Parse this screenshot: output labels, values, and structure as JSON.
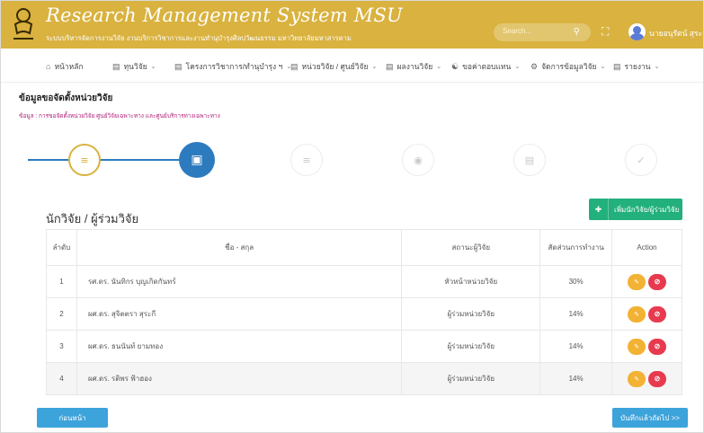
{
  "header": {
    "title": "Research Management System MSU",
    "subtitle": "ระบบบริหารจัดการงานวิจัย งานบริการวิชาการและงานทำนุบำรุงศิลปวัฒนธรรม มหาวิทยาลัยมหาสารคาม",
    "search_placeholder": "Search...",
    "user_name": "นายอนุรัตน์ สุระจันทร์"
  },
  "nav": {
    "items": [
      {
        "label": "หน้าหลัก",
        "icon": "home-icon"
      },
      {
        "label": "ทุนวิจัย",
        "icon": "grant-icon"
      },
      {
        "label": "โครงการวิชาการ/ทำนุบำรุง ฯ",
        "icon": "project-icon"
      },
      {
        "label": "หน่วยวิจัย / ศูนย์วิจัย",
        "icon": "unit-icon"
      },
      {
        "label": "ผลงานวิจัย",
        "icon": "output-icon"
      },
      {
        "label": "ขอค่าตอบแทน",
        "icon": "reward-icon"
      },
      {
        "label": "จัดการข้อมูลวิจัย",
        "icon": "settings-icon"
      },
      {
        "label": "รายงาน",
        "icon": "report-icon"
      }
    ]
  },
  "page": {
    "title": "ข้อมูลขอจัดตั้งหน่วยวิจัย",
    "subtitle": "ข้อมูล : การขอจัดตั้งหน่วยวิจัย ศูนย์วิจัยเฉพาะทาง และศูนย์บริการทางเฉพาะทาง"
  },
  "stepper": {
    "steps": [
      {
        "state": "done",
        "icon": "list-icon"
      },
      {
        "state": "active",
        "icon": "document-icon"
      },
      {
        "state": "todo",
        "icon": "list-icon"
      },
      {
        "state": "todo",
        "icon": "coin-icon"
      },
      {
        "state": "todo",
        "icon": "file-icon"
      },
      {
        "state": "todo",
        "icon": "check-circle-icon"
      }
    ]
  },
  "researchers": {
    "title": "นักวิจัย / ผู้ร่วมวิจัย",
    "add_button": "เพิ่มนักวิจัย/ผู้ร่วมวิจัย",
    "columns": [
      "ลำดับ",
      "ชื่อ - สกุล",
      "สถานะผู้วิจัย",
      "สัดส่วนการทำงาน",
      "Action"
    ],
    "rows": [
      {
        "no": "1",
        "name": "รศ.ดร. นันทิกร บุญเกิดกันทร์",
        "status": "หัวหน้าหน่วยวิจัย",
        "share": "30%"
      },
      {
        "no": "2",
        "name": "ผศ.ดร. สุจิตตรา สุระกี",
        "status": "ผู้ร่วมหน่วยวิจัย",
        "share": "14%"
      },
      {
        "no": "3",
        "name": "ผศ.ดร. ธนนันท์ ยามทอง",
        "status": "ผู้ร่วมหน่วยวิจัย",
        "share": "14%"
      },
      {
        "no": "4",
        "name": "ผศ.ดร. รติพร ฟ้าฮอง",
        "status": "ผู้ร่วมหน่วยวิจัย",
        "share": "14%"
      }
    ]
  },
  "footer": {
    "back_button": "ก่อนหน้า",
    "next_button": "บันทึกแล้วถัดไป >>"
  },
  "colors": {
    "header": "#d9b23f",
    "primary": "#2d7bbf",
    "success": "#22b07d",
    "warning": "#f2b233",
    "danger": "#e83a4f",
    "info": "#3ca3db"
  }
}
